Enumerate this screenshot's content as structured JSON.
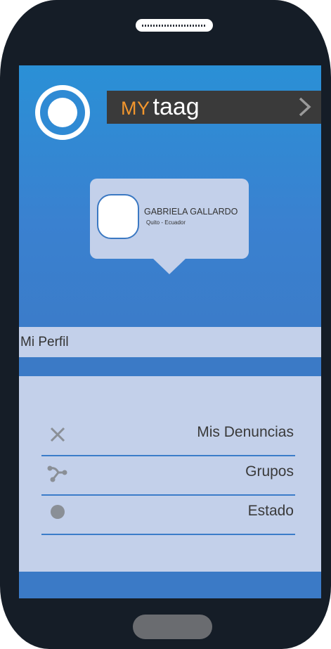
{
  "brand": {
    "my": "MY",
    "name": "taag"
  },
  "profile_card": {
    "name": "GABRIELA GALLARDO",
    "location": "Quito - Ecuador"
  },
  "section_title": "Mi Perfil",
  "menu": {
    "items": [
      {
        "label": "Mis Denuncias",
        "icon": "close-icon"
      },
      {
        "label": "Grupos",
        "icon": "share-icon"
      },
      {
        "label": "Estado",
        "icon": "circle-icon"
      }
    ]
  },
  "colors": {
    "accent_orange": "#f2962d",
    "primary_blue": "#3b7ac6",
    "panel_light": "#c3d0ea",
    "brand_bar": "#3a3a3a"
  }
}
